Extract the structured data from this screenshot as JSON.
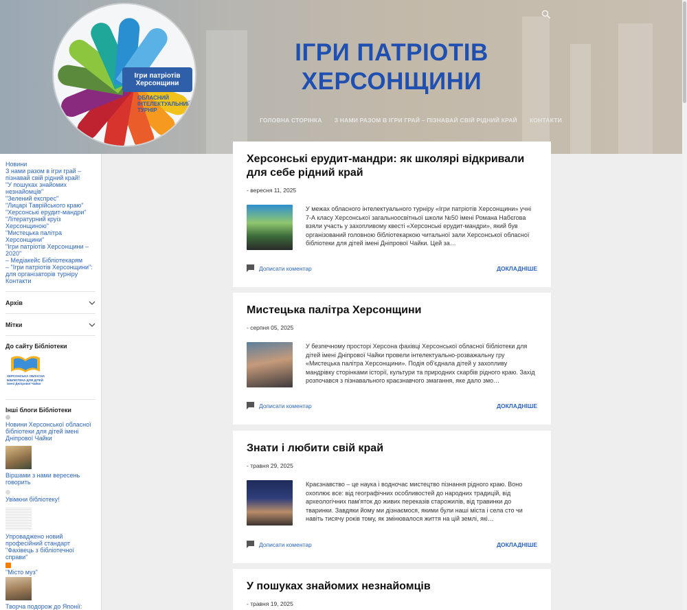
{
  "header": {
    "site_title": "ІГРИ ПАТРІОТІВ ХЕРСОНЩИНИ",
    "logo": {
      "band_text": "Ігри патріотів Херсонщини",
      "sub_text": "ОБЛАСНИЙ ІНТЕЛЕКТУАЛЬНИЙ ТУРНІР"
    },
    "search_icon": "search-icon",
    "nav": [
      "ГОЛОВНА СТОРІНКА",
      "З НАМИ РАЗОМ В ІГРИ ГРАЙ – ПІЗНАВАЙ СВІЙ РІДНИЙ КРАЙ",
      "КОНТАКТИ"
    ]
  },
  "sidebar": {
    "links": [
      "Новини",
      "З нами разом в ігри грай – пізнавай свій рідний край!",
      "\"У пошуках знайомих незнайомців\"",
      "\"Зелений експрес\"",
      "\"Лицарі Таврійського краю\"",
      "\"Херсонські ерудит-мандри\"",
      "\"Літературний круіз Херсонщиною\"",
      "\"Мистецька палітра Херсонщини\"",
      "\"Ігри патріотів Херсонщини – 2020\"",
      "– Медіакейс Бібліотекарям",
      "– \"Ігри патріотів Херсонщини\": для організаторів турніру",
      "Контакти"
    ],
    "archive_label": "Архів",
    "labels_label": "Мітки",
    "library_title": "До сайту Бібліотеки",
    "library_logo_text": "ХЕРСОНСЬКА ОБЛАСНА БІБЛІОТЕКА ДЛЯ ДІТЕЙ імені Дніпрової Чайки",
    "blogs_title": "Інші блоги Бібліотеки",
    "blogs": [
      "Новини Херсонської обласної бібліотеки для дітей імені Дніпрової Чайки",
      "Віршами з нами вересень говорить",
      "Увімкни бібліотеку!",
      "Упроваджено новий професійний стандарт \"Фахівець з бібліотечної справи\"",
      "\"Місто муз\"",
      "Творча подорож до Японії: знайомство із Хокусаєм"
    ]
  },
  "posts": [
    {
      "title": "Херсонські ерудит-мандри: як школярі відкривали для себе рідний край",
      "date": "- вересня 11, 2025",
      "snippet": "У межах обласного інтелектуального турніру «Ігри патріотів Херсонщини» учні 7-А класу Херсонської загальноосвітньої школи №50 імені Романа Набєгова взяли участь у захопливому квесті «Херсонські ерудит-мандри», який був організований головною бібліотекаркою читальної зали Херсонської обласної бібліотеки для дітей імені Дніпрової Чайки. Цей за…",
      "comment": "Дописати коментар",
      "more": "Докладніше"
    },
    {
      "title": "Мистецька палітра Херсонщини",
      "date": "- серпня 05, 2025",
      "snippet": "У безпечному просторі Херсона фахівці Херсонської обласної бібліотеки для дітей імені Дніпрової Чайки провели інтелектуально-розважальну гру «Мистецька палітра Херсонщини». Подія об'єднала дітей у захопливу мандрівку сторінками історії, культури та природних скарбів рідного краю. Захід розпочався з пізнавального краєзнавчого змагання, яке дало змо…",
      "comment": "Дописати коментар",
      "more": "Докладніше"
    },
    {
      "title": "Знати і любити свій край",
      "date": "- травня 29, 2025",
      "snippet": "Краєзнавство – це наука і водночас мистецтво пізнання рідного краю. Воно охоплює все: від географічних особливостей до народних традицій, від археологічних пам'яток до живих переказів старожилів, від травинки до тваринки. Завдяки йому ми дізнаємося, якими були наші міста і села сто чи навіть тисячу років тому, як змінювалося життя на цій землі, які…",
      "comment": "Дописати коментар",
      "more": "Докладніше"
    },
    {
      "title": "У пошуках знайомих незнайомців",
      "date": "- травня 19, 2025"
    }
  ],
  "colors": {
    "link": "#2b64b9",
    "title": "#1f4fb0",
    "background": "#eeeeee"
  }
}
